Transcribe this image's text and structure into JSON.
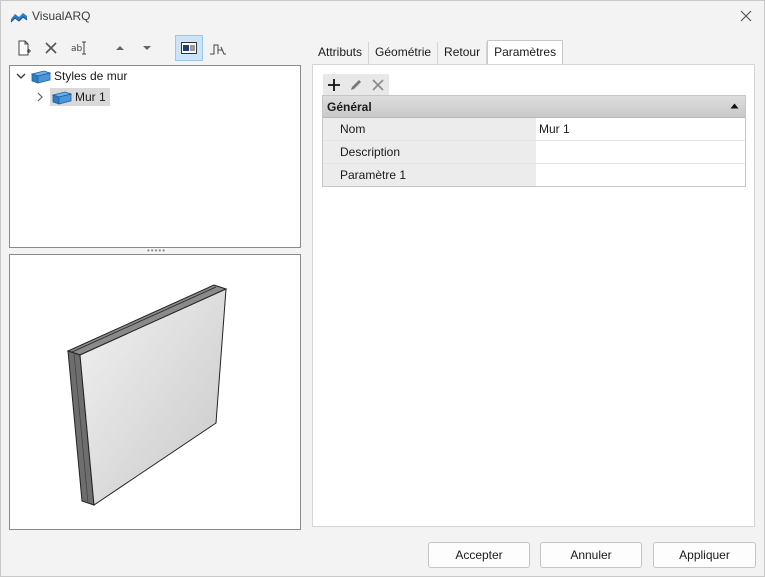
{
  "window": {
    "title": "VisualARQ"
  },
  "toolbar": {
    "buttons": [
      {
        "name": "new-style-icon"
      },
      {
        "name": "delete-icon"
      },
      {
        "name": "rename-icon"
      },
      {
        "name": "move-up-icon"
      },
      {
        "name": "move-down-icon"
      },
      {
        "name": "preview-toggle-icon"
      },
      {
        "name": "section-view-icon"
      }
    ]
  },
  "tree": {
    "root_label": "Styles de mur",
    "child_label": "Mur 1"
  },
  "tabs": [
    {
      "label": "Attributs"
    },
    {
      "label": "Géométrie"
    },
    {
      "label": "Retour"
    },
    {
      "label": "Paramètres",
      "active": true
    }
  ],
  "params": {
    "section_title": "Général",
    "rows": [
      {
        "name": "Nom",
        "value": "Mur 1"
      },
      {
        "name": "Description",
        "value": ""
      },
      {
        "name": "Paramètre 1",
        "value": ""
      }
    ]
  },
  "footer": {
    "accept": "Accepter",
    "cancel": "Annuler",
    "apply": "Appliquer"
  },
  "colors": {
    "accent": "#1e7fd0",
    "window_bg": "#f3f3f3",
    "active_tool_bg": "#cce4f7"
  }
}
